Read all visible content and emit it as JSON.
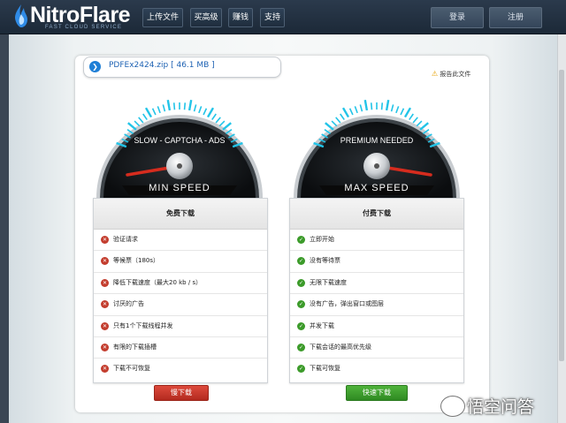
{
  "brand": {
    "name": "NitroFlare",
    "tagline": "FAST CLOUD SERVICE"
  },
  "nav": [
    "上传文件",
    "买高级",
    "赚钱",
    "支持"
  ],
  "auth": {
    "login": "登录",
    "register": "注册"
  },
  "file": {
    "label": "PDFEx2424.zip [ 46.1 MB ]"
  },
  "report_label": "报告此文件",
  "gauges": {
    "free": {
      "top_text": "SLOW - CAPTCHA - ADS",
      "bottom_text": "MIN SPEED"
    },
    "premium": {
      "top_text": "PREMIUM NEEDED",
      "bottom_text": "MAX SPEED"
    }
  },
  "free": {
    "title": "免费下载",
    "items": [
      "验证请求",
      "等候票（180s）",
      "降低下载速度（最大20 kb / s）",
      "讨厌的广告",
      "只有1个下载线程并发",
      "有限的下载插槽",
      "下载不可恢复"
    ],
    "button": "慢下载"
  },
  "premium": {
    "title": "付费下载",
    "items": [
      "立即开始",
      "没有等待票",
      "无限下载速度",
      "没有广告，弹出窗口或图层",
      "并发下载",
      "下载会话的最高优先级",
      "下载可恢复"
    ],
    "button": "快速下载"
  },
  "watermark": "悟空问答",
  "colors": {
    "link": "#1e62b3",
    "slow": "#c33d2e",
    "fast": "#3c9b2a",
    "needle": "#d62c1e"
  }
}
